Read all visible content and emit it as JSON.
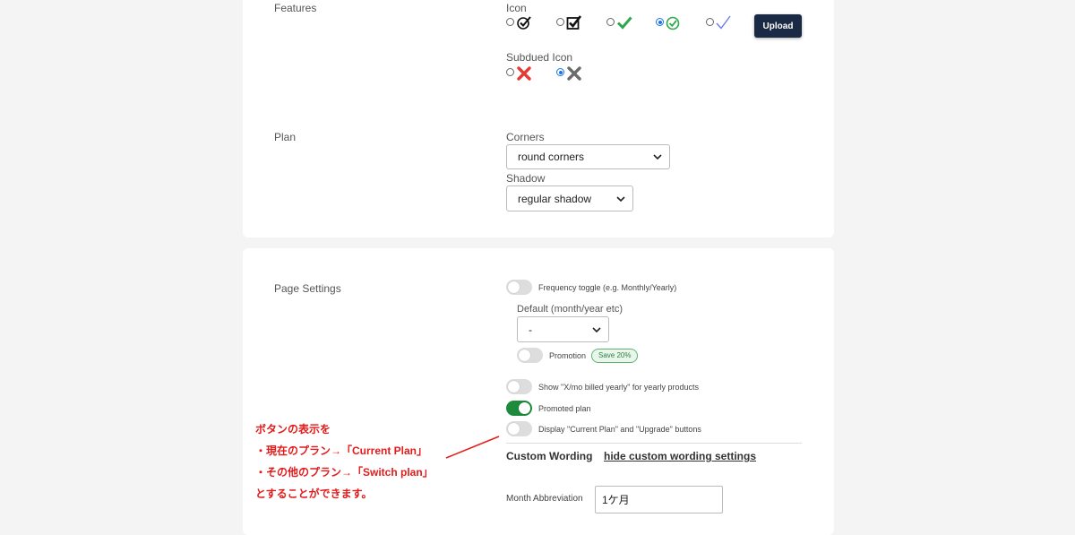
{
  "features": {
    "section_label": "Features",
    "icon_label": "Icon",
    "subdued_label": "Subdued Icon",
    "upload_label": "Upload",
    "icon_options": [
      {
        "icon": "circle-check-outline-icon",
        "selected": false
      },
      {
        "icon": "box-check-icon",
        "selected": false
      },
      {
        "icon": "green-check-icon",
        "selected": false
      },
      {
        "icon": "green-circle-check-icon",
        "selected": true
      },
      {
        "icon": "thin-blue-check-icon",
        "selected": false
      }
    ],
    "subdued_options": [
      {
        "icon": "red-x-icon",
        "selected": false
      },
      {
        "icon": "gray-x-icon",
        "selected": true
      }
    ]
  },
  "plan": {
    "section_label": "Plan",
    "corners_label": "Corners",
    "corners_value": "round corners",
    "shadow_label": "Shadow",
    "shadow_value": "regular shadow"
  },
  "page_settings": {
    "section_label": "Page Settings",
    "frequency_toggle_label": "Frequency toggle (e.g. Monthly/Yearly)",
    "default_label": "Default (month/year etc)",
    "default_value": "-",
    "promotion_label": "Promotion",
    "promotion_badge": "Save 20%",
    "show_yearly_label": "Show \"X/mo billed yearly\" for yearly products",
    "promoted_plan_label": "Promoted plan",
    "display_buttons_label": "Display \"Current Plan\" and \"Upgrade\" buttons",
    "toggles": {
      "frequency": false,
      "promotion": false,
      "show_yearly": false,
      "promoted_plan": true,
      "display_buttons": false
    },
    "custom_wording_title": "Custom Wording",
    "hide_custom_wording_link": "hide custom wording settings",
    "month_abbreviation_label": "Month Abbreviation",
    "month_abbreviation_value": "1ケ月"
  },
  "annotation": {
    "line1": "ボタンの表示を",
    "line2": "・現在のプラン→「Current Plan」",
    "line3": "・その他のプラン→「Switch plan」",
    "line4": "とすることができます。",
    "color": "#e21b1b"
  }
}
